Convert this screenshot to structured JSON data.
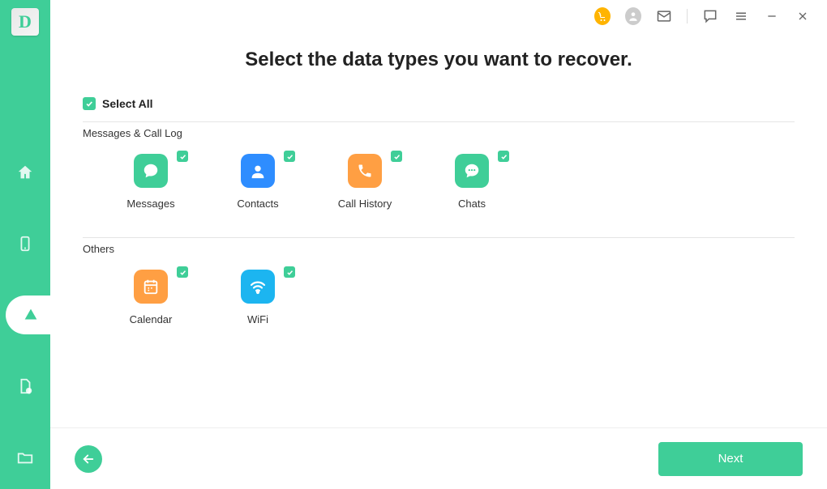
{
  "app_logo_letter": "D",
  "header": {
    "title": "Select the data types you want to recover."
  },
  "select_all": {
    "label": "Select All",
    "checked": true
  },
  "sections": [
    {
      "label": "Messages & Call Log",
      "items": [
        {
          "id": "messages",
          "label": "Messages",
          "color": "green",
          "checked": true
        },
        {
          "id": "contacts",
          "label": "Contacts",
          "color": "blue",
          "checked": true
        },
        {
          "id": "call-history",
          "label": "Call History",
          "color": "orange",
          "checked": true
        },
        {
          "id": "chats",
          "label": "Chats",
          "color": "green",
          "checked": true
        }
      ]
    },
    {
      "label": "Others",
      "items": [
        {
          "id": "calendar",
          "label": "Calendar",
          "color": "orange",
          "checked": true
        },
        {
          "id": "wifi",
          "label": "WiFi",
          "color": "skyblue",
          "checked": true
        }
      ]
    }
  ],
  "footer": {
    "next_label": "Next"
  }
}
